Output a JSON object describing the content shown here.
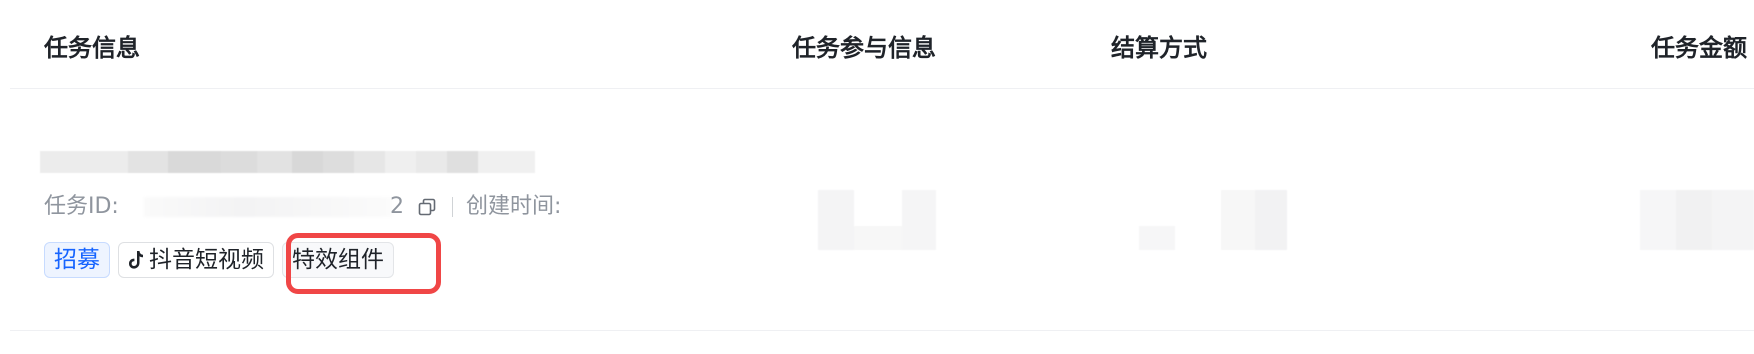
{
  "table": {
    "headers": {
      "task_info": "任务信息",
      "participation_info": "任务参与信息",
      "settlement_method": "结算方式",
      "task_amount": "任务金额"
    },
    "rows": [
      {
        "task_id_label": "任务ID:",
        "task_id_visible_tail": "2",
        "created_time_label": "创建时间:",
        "tags": {
          "recruit": "招募",
          "platform": "抖音短视频",
          "effects": "特效组件"
        }
      }
    ]
  },
  "colors": {
    "recruit_tag": "#1664ff",
    "highlight": "#f04646",
    "muted_text": "#8f959e"
  },
  "icons": {
    "copy": "copy-icon",
    "platform": "tiktok-icon"
  }
}
